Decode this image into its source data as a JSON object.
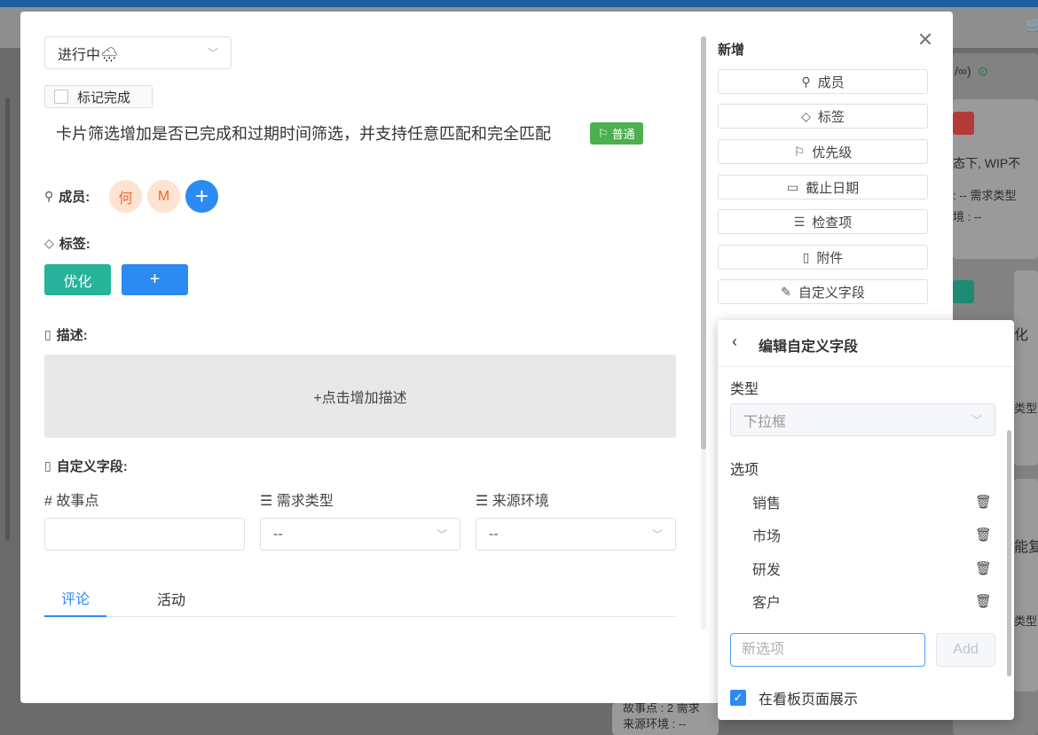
{
  "background": {
    "col_header_text": "/∞)",
    "card1_text1": "态下, WIP不",
    "card1_text2": ": --  需求类型",
    "card1_text3": "境 : --",
    "card2_text": "化",
    "card2_text2": "类型",
    "card3_text": "能复",
    "card3_text2": "类型",
    "bottom_text1": "故事点 : 2  需求",
    "bottom_text2": "来源环境 : --"
  },
  "card": {
    "status": "进行中🌧",
    "mark_done_label": "标记完成",
    "title": "卡片筛选增加是否已完成和过期时间筛选，并支持任意匹配和完全匹配",
    "priority_tag": "普通",
    "members_label": "成员:",
    "members": [
      "何",
      "M"
    ],
    "members_add": "+",
    "tags_label": "标签:",
    "tags": [
      "优化"
    ],
    "tags_add": "+",
    "description_label": "描述:",
    "description_placeholder": "+点击增加描述",
    "custom_fields_label": "自定义字段:",
    "custom_fields": [
      {
        "label": "# 故事点",
        "value": ""
      },
      {
        "label": "☰ 需求类型",
        "value": "--"
      },
      {
        "label": "☰ 来源环境",
        "value": "--"
      }
    ],
    "tabs": [
      {
        "label": "评论",
        "active": true
      },
      {
        "label": "活动",
        "active": false
      }
    ]
  },
  "sidebar": {
    "title": "新增",
    "buttons": [
      {
        "icon": "user-icon",
        "label": "成员"
      },
      {
        "icon": "tag-icon",
        "label": "标签"
      },
      {
        "icon": "flag-icon",
        "label": "优先级"
      },
      {
        "icon": "calendar-icon",
        "label": "截止日期"
      },
      {
        "icon": "checklist-icon",
        "label": "检查项"
      },
      {
        "icon": "file-icon",
        "label": "附件"
      },
      {
        "icon": "edit-icon",
        "label": "自定义字段"
      }
    ]
  },
  "popover": {
    "title": "编辑自定义字段",
    "type_label": "类型",
    "type_value": "下拉框",
    "options_label": "选项",
    "options": [
      "销售",
      "市场",
      "研发",
      "客户"
    ],
    "new_option_placeholder": "新选项",
    "add_button": "Add",
    "show_on_board_label": "在看板页面展示",
    "show_on_board_checked": true
  },
  "colors": {
    "primary": "#2b8bf2",
    "tag_green": "#26b39a",
    "priority_green": "#4caf50",
    "avatar_bg": "#fde3d2",
    "avatar_text": "#f06a2a"
  }
}
